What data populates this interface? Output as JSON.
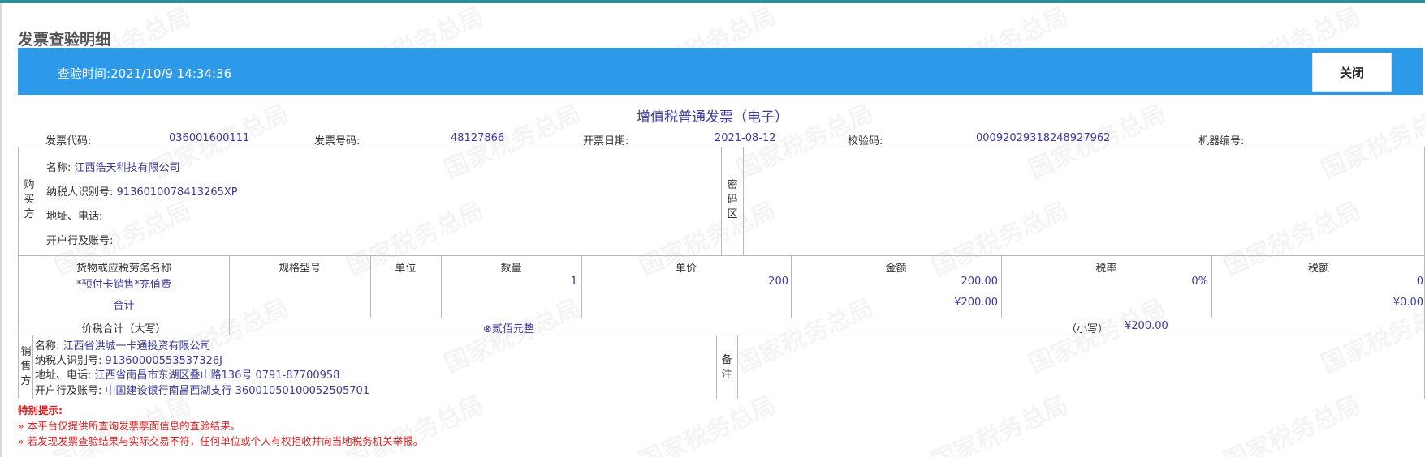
{
  "page_title": "发票查验明细",
  "banner": {
    "check_time_label": "查验时间:",
    "check_time_value": "2021/10/9 14:34:36",
    "close_label": "关闭"
  },
  "invoice": {
    "title": "增值税普通发票（电子）",
    "code_label": "发票代码:",
    "code_value": "036001600111",
    "number_label": "发票号码:",
    "number_value": "48127866",
    "date_label": "开票日期:",
    "date_value": "2021-08-12",
    "check_label": "校验码:",
    "check_value": "00092029318248927962",
    "machine_label": "机器编号:"
  },
  "buyer": {
    "side_label": [
      "购",
      "买",
      "方"
    ],
    "name_label": "名称:",
    "name_value": "江西浩天科技有限公司",
    "tax_label": "纳税人识别号:",
    "tax_value": "9136010078413265XP",
    "addr_label": "地址、电话:",
    "addr_value": "",
    "bank_label": "开户行及账号:",
    "bank_value": ""
  },
  "cipher": {
    "label": [
      "密",
      "码",
      "区"
    ]
  },
  "items": {
    "headers": [
      "货物或应税劳务名称",
      "规格型号",
      "单位",
      "数量",
      "单价",
      "金额",
      "税率",
      "税额"
    ],
    "rows": [
      {
        "name": "*预付卡销售*充值费",
        "spec": "",
        "unit": "",
        "qty": "1",
        "price": "200",
        "amount": "200.00",
        "rate": "0%",
        "tax": "0"
      }
    ],
    "subtotal_label": "合计",
    "subtotal_amount": "¥200.00",
    "subtotal_tax": "¥0.00"
  },
  "total": {
    "label": "价税合计（大写）",
    "upper_value": "⊗贰佰元整",
    "lower_label": "（小写）",
    "lower_value": "¥200.00"
  },
  "seller": {
    "side_label": [
      "销",
      "售",
      "方"
    ],
    "name_label": "名称:",
    "name_value": "江西省洪城一卡通投资有限公司",
    "tax_label": "纳税人识别号:",
    "tax_value": "91360000553537326J",
    "addr_label": "地址、电话:",
    "addr_value": "江西省南昌市东湖区叠山路136号 0791-87700958",
    "bank_label": "开户行及账号:",
    "bank_value": "中国建设银行南昌西湖支行 36001050100052505701"
  },
  "remark": {
    "label": [
      "备",
      "注"
    ]
  },
  "notice": {
    "title": "特别提示:",
    "lines": [
      "»  本平台仅提供所查询发票票面信息的查验结果。",
      "»  若发现发票查验结果与实际交易不符，任何单位或个人有权拒收并向当地税务机关举报。"
    ]
  },
  "watermark_text": "国家税务总局"
}
